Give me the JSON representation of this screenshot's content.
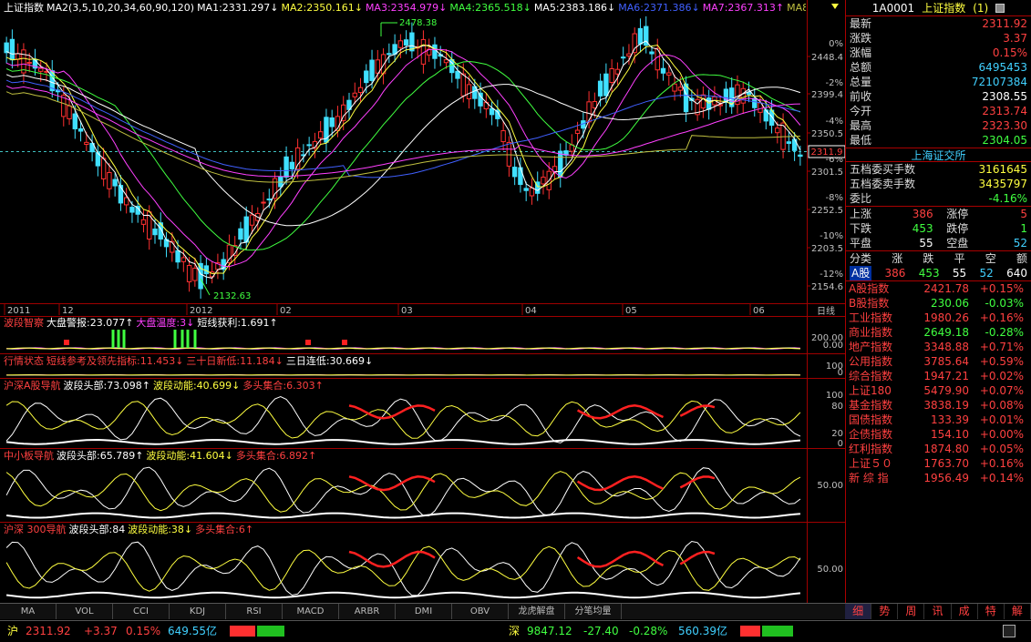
{
  "main_panel": {
    "ma_labels": [
      {
        "text": "上证指数",
        "color": "#ffffff"
      },
      {
        "text": "MA2(3,5,10,20,34,60,90,120)",
        "color": "#ffffff"
      },
      {
        "text": "MA1:2331.297↓",
        "color": "#ffffff"
      },
      {
        "text": "MA2:2350.161↓",
        "color": "#ffff40"
      },
      {
        "text": "MA3:2354.979↓",
        "color": "#ff40ff"
      },
      {
        "text": "MA4:2365.518↓",
        "color": "#40ff40"
      },
      {
        "text": "MA5:2383.186↓",
        "color": "#ffffff"
      },
      {
        "text": "MA6:2371.386↓",
        "color": "#4060ff"
      },
      {
        "text": "MA7:2367.313↑",
        "color": "#ff40ff"
      },
      {
        "text": "MA8:2334.51↓",
        "color": "#c0c040"
      }
    ],
    "y_ticks": [
      "2448.4",
      "2399.4",
      "2350.5",
      "2301.5",
      "2252.5",
      "2203.5",
      "2154.6"
    ],
    "pct_ticks": [
      "0%",
      "-2%",
      "-4%",
      "-6%",
      "-8%",
      "-10%",
      "-12%"
    ],
    "current_price_tag": "2311.9",
    "high_label": "2478.38",
    "low_label": "2132.63",
    "x_labels": [
      "2011",
      "12",
      "2012",
      "02",
      "03",
      "04",
      "05",
      "06"
    ],
    "period_label": "日线"
  },
  "subpanels": [
    {
      "name": "波段智察",
      "labels": [
        {
          "text": "波段智察",
          "color": "#ff4040"
        },
        {
          "text": "大盘警报:23.077↑",
          "color": "#ffffff"
        },
        {
          "text": "大盘温度:3↓",
          "color": "#ff40ff"
        },
        {
          "text": "短线获利:1.691↑",
          "color": "#ffffff"
        }
      ],
      "ticks": [
        "200.00",
        "0.00"
      ]
    },
    {
      "name": "行情状态",
      "labels": [
        {
          "text": "行情状态",
          "color": "#ff4040"
        },
        {
          "text": "短线参考及领先指标:11.453↓",
          "color": "#ff4040"
        },
        {
          "text": "三十日新低:11.184↓",
          "color": "#ff4040"
        },
        {
          "text": "三日连低:30.669↓",
          "color": "#ffffff"
        }
      ],
      "ticks": [
        "100",
        "0"
      ]
    },
    {
      "name": "沪深A股导航",
      "labels": [
        {
          "text": "沪深A股导航",
          "color": "#ff4040"
        },
        {
          "text": "波段头部:73.098↑",
          "color": "#ffffff"
        },
        {
          "text": "波段动能:40.699↓",
          "color": "#ffff40"
        },
        {
          "text": "多头集合:6.303↑",
          "color": "#ff4040"
        }
      ],
      "ticks": [
        "100",
        "80",
        "20",
        "0"
      ]
    },
    {
      "name": "中小板导航",
      "labels": [
        {
          "text": "中小板导航",
          "color": "#ff4040"
        },
        {
          "text": "波段头部:65.789↑",
          "color": "#ffffff"
        },
        {
          "text": "波段动能:41.604↓",
          "color": "#ffff40"
        },
        {
          "text": "多头集合:6.892↑",
          "color": "#ff4040"
        }
      ],
      "ticks": [
        "50.00"
      ]
    },
    {
      "name": "沪深300导航",
      "labels": [
        {
          "text": "沪深 300导航",
          "color": "#ff4040"
        },
        {
          "text": "波段头部:84",
          "color": "#ffffff"
        },
        {
          "text": "波段动能:38↓",
          "color": "#ffff40"
        },
        {
          "text": "多头集合:6↑",
          "color": "#ff4040"
        }
      ],
      "ticks": [
        "50.00"
      ]
    }
  ],
  "bottom_tabs": [
    "MA",
    "VOL",
    "CCI",
    "KDJ",
    "RSI",
    "MACD",
    "ARBR",
    "DMI",
    "OBV",
    "龙虎解盘",
    "分笔均量"
  ],
  "quote": {
    "code": "1A0001",
    "name": "上证指数",
    "suffix": "(1)",
    "rows": [
      {
        "label": "最新",
        "value": "2311.92",
        "color": "#ff4040"
      },
      {
        "label": "涨跌",
        "value": "3.37",
        "color": "#ff4040"
      },
      {
        "label": "涨幅",
        "value": "0.15%",
        "color": "#ff4040"
      },
      {
        "label": "总额",
        "value": "6495453",
        "color": "#40d0ff"
      },
      {
        "label": "总量",
        "value": "72107384",
        "color": "#40d0ff"
      },
      {
        "label": "前收",
        "value": "2308.55",
        "color": "#ffffff"
      },
      {
        "label": "今开",
        "value": "2313.74",
        "color": "#ff4040"
      },
      {
        "label": "最高",
        "value": "2323.30",
        "color": "#ff4040"
      },
      {
        "label": "最低",
        "value": "2304.05",
        "color": "#40ff40"
      }
    ],
    "exchange": "上海证交所",
    "book": [
      {
        "label": "五档委买手数",
        "value": "3161645",
        "color": "#ffff40"
      },
      {
        "label": "五档委卖手数",
        "value": "3435797",
        "color": "#ffff40"
      },
      {
        "label": "委比",
        "value": "-4.16%",
        "color": "#40ff40"
      }
    ],
    "breadth": [
      {
        "l1": "上涨",
        "v1": "386",
        "c1": "#ff4040",
        "l2": "涨停",
        "v2": "5",
        "c2": "#ff4040"
      },
      {
        "l1": "下跌",
        "v1": "453",
        "c1": "#40ff40",
        "l2": "跌停",
        "v2": "1",
        "c2": "#40ff40"
      },
      {
        "l1": "平盘",
        "v1": "55",
        "c1": "#ffffff",
        "l2": "空盘",
        "v2": "52",
        "c2": "#40d0ff"
      }
    ],
    "cat_header": [
      "分类",
      "涨",
      "跌",
      "平",
      "空",
      "额"
    ],
    "cat_row": {
      "name": "A股",
      "up": "386",
      "down": "453",
      "flat": "55",
      "susp": "52",
      "amt": "640"
    },
    "indices": [
      {
        "name": "A股指数",
        "value": "2421.78",
        "pct": "+0.15%",
        "color": "#ff4040"
      },
      {
        "name": "B股指数",
        "value": "230.06",
        "pct": "-0.03%",
        "color": "#40ff40"
      },
      {
        "name": "工业指数",
        "value": "1980.26",
        "pct": "+0.16%",
        "color": "#ff4040"
      },
      {
        "name": "商业指数",
        "value": "2649.18",
        "pct": "-0.28%",
        "color": "#40ff40"
      },
      {
        "name": "地产指数",
        "value": "3348.88",
        "pct": "+0.71%",
        "color": "#ff4040"
      },
      {
        "name": "公用指数",
        "value": "3785.64",
        "pct": "+0.59%",
        "color": "#ff4040"
      },
      {
        "name": "综合指数",
        "value": "1947.21",
        "pct": "+0.02%",
        "color": "#ff4040"
      },
      {
        "name": "上证180",
        "value": "5479.90",
        "pct": "+0.07%",
        "color": "#ff4040"
      },
      {
        "name": "基金指数",
        "value": "3838.19",
        "pct": "+0.08%",
        "color": "#ff4040"
      },
      {
        "name": "国债指数",
        "value": "133.39",
        "pct": "+0.01%",
        "color": "#ff4040"
      },
      {
        "name": "企债指数",
        "value": "154.10",
        "pct": "+0.00%",
        "color": "#ff4040"
      },
      {
        "name": "红利指数",
        "value": "1874.80",
        "pct": "+0.05%",
        "color": "#ff4040"
      },
      {
        "name": "上证５０",
        "value": "1763.70",
        "pct": "+0.16%",
        "color": "#ff4040"
      },
      {
        "name": "新 综 指",
        "value": "1956.49",
        "pct": "+0.14%",
        "color": "#ff4040"
      }
    ],
    "nav_tabs": [
      "细",
      "势",
      "周",
      "讯",
      "成",
      "特",
      "解"
    ]
  },
  "status": {
    "sh_label": "沪",
    "sh_price": "2311.92",
    "sh_chg": "+3.37",
    "sh_pct": "0.15%",
    "sh_amt": "649.55亿",
    "sz_label": "深",
    "sz_price": "9847.12",
    "sz_chg": "-27.40",
    "sz_pct": "-0.28%",
    "sz_amt": "560.39亿"
  },
  "chart_data": {
    "type": "line",
    "title": "上证指数",
    "ylim": [
      2132.63,
      2478.38
    ],
    "note_series": "daily candlestick 2011-11 to 2012-06 with moving averages"
  }
}
